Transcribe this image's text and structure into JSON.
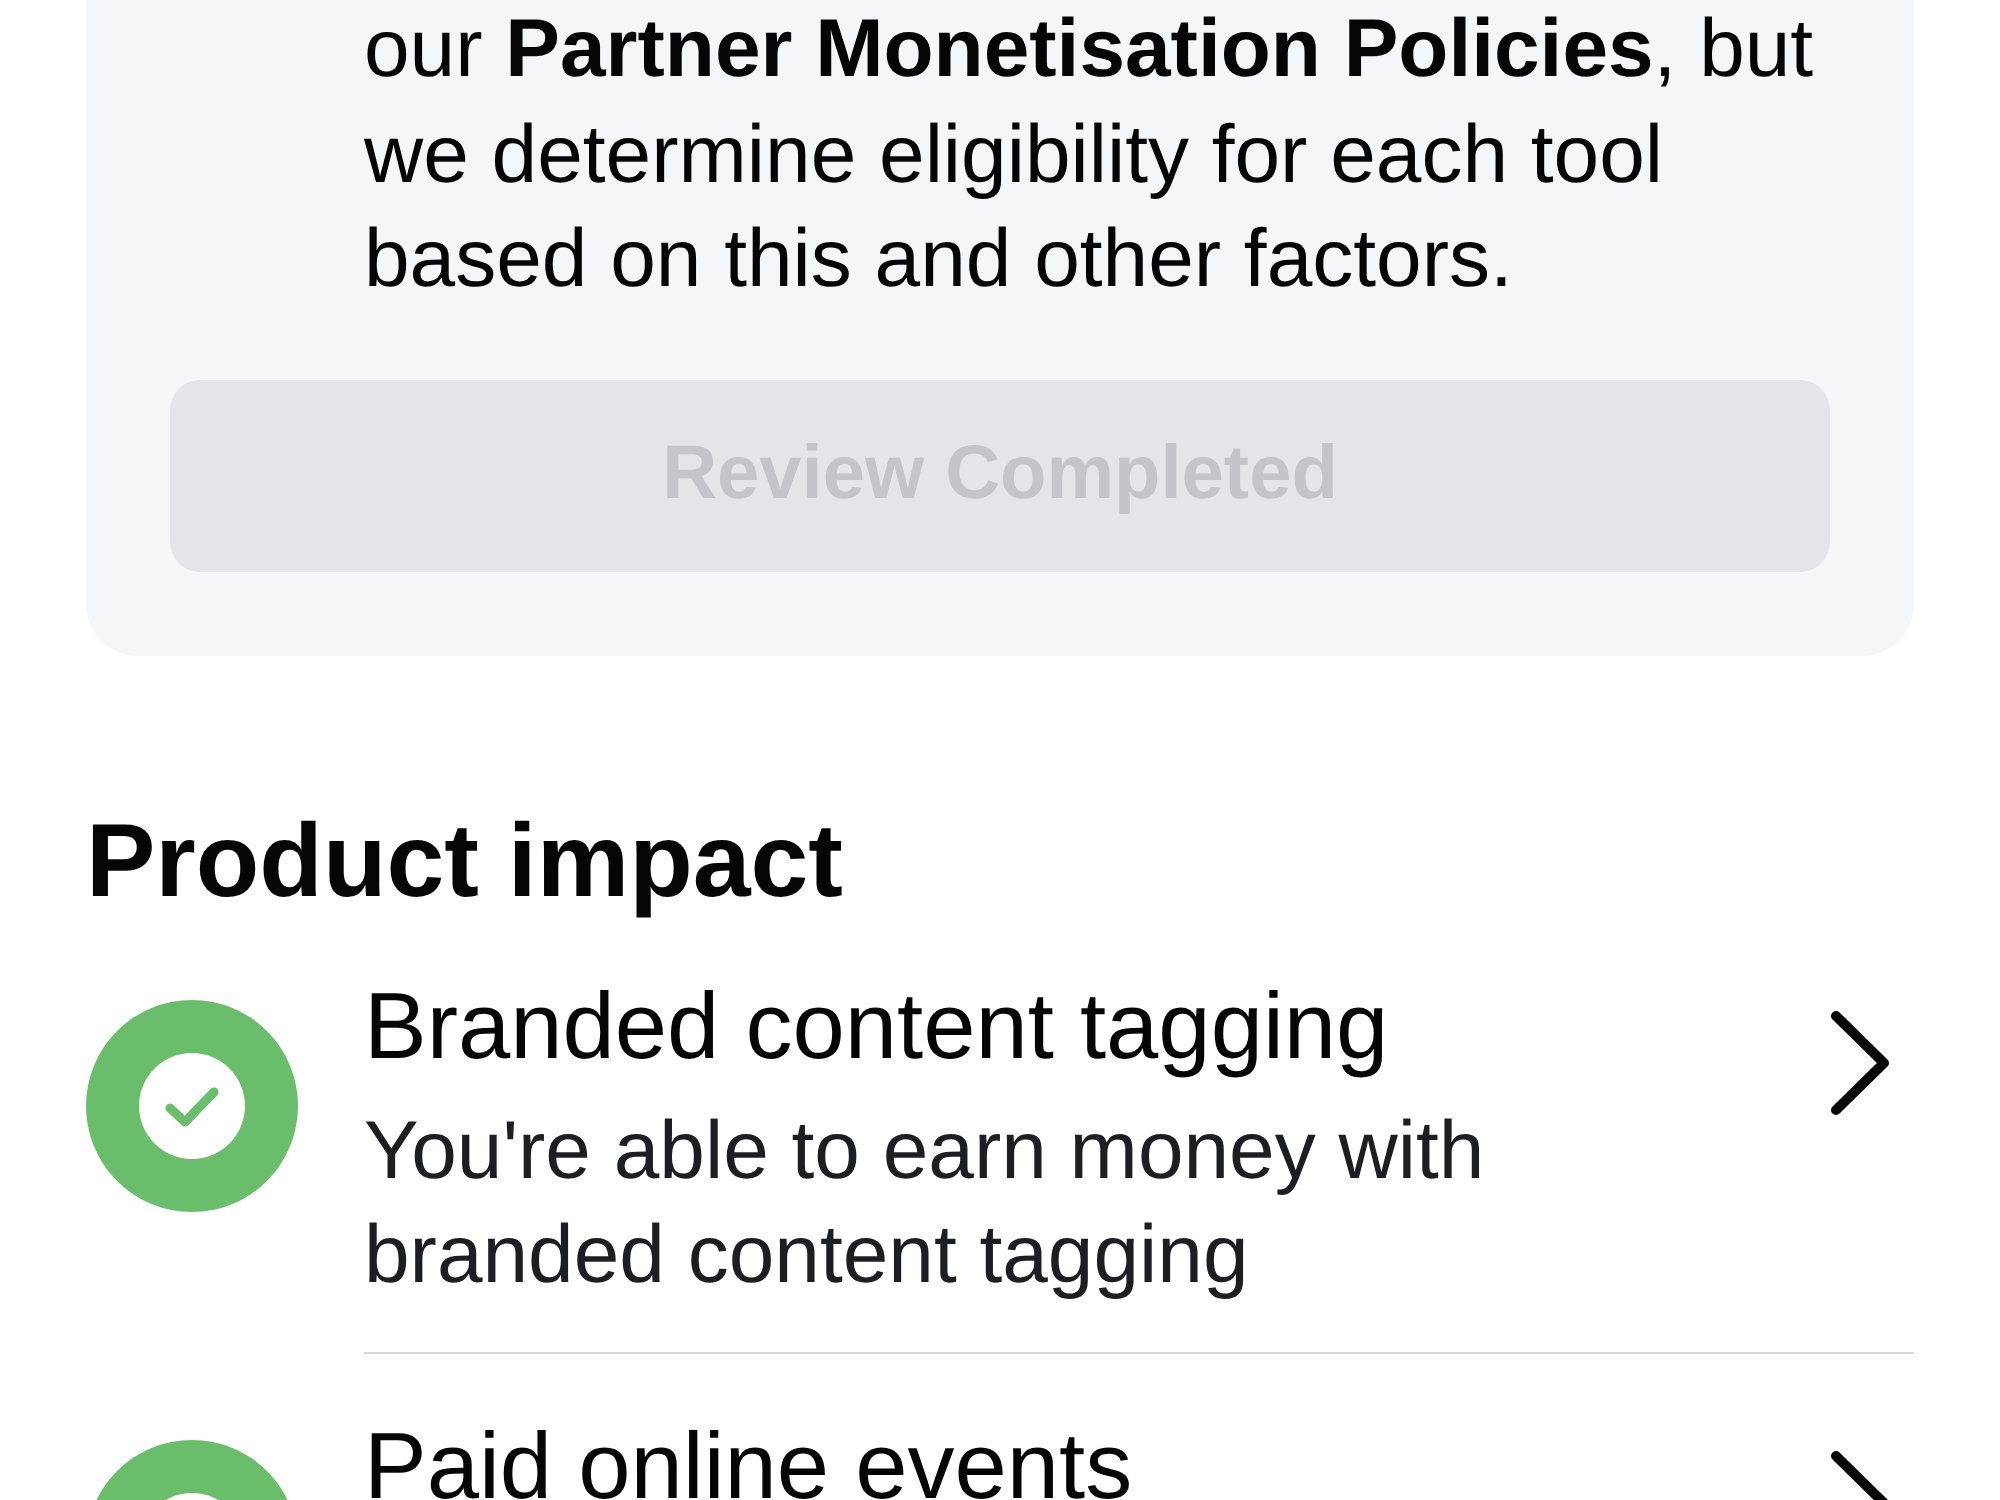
{
  "card": {
    "text": "our **Partner Monetisation Policies**, but we determine eligibility for each tool based on this and other factors.",
    "button": {
      "label": "Review Completed",
      "disabled": true
    }
  },
  "section": {
    "title": "Product impact",
    "items": [
      {
        "title": "Branded content tagging",
        "description": "You're able to earn money with branded content tagging",
        "eligible": true
      },
      {
        "title": "Paid online events",
        "eligible": true
      }
    ]
  }
}
